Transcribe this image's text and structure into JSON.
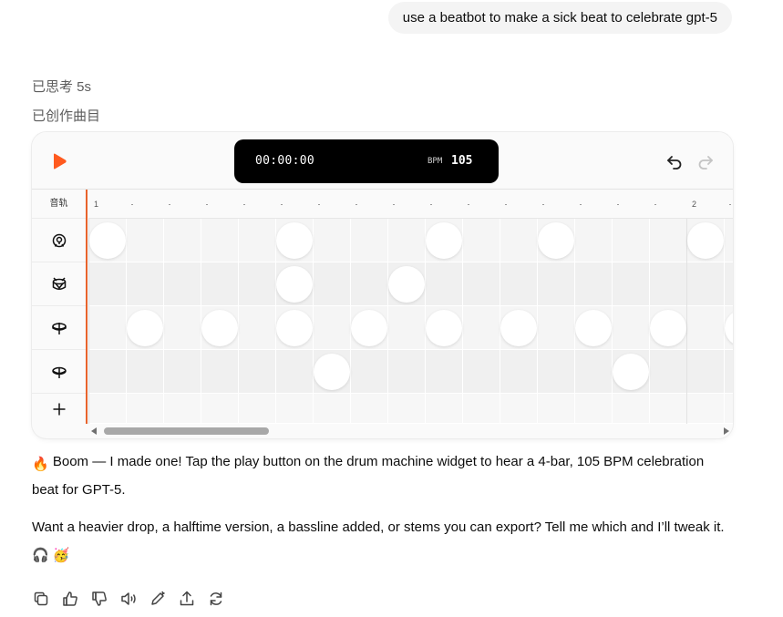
{
  "user_message": "use a beatbot to make a sick beat to celebrate gpt-5",
  "thought_label": "已思考 5s",
  "created_label": "已创作曲目",
  "widget": {
    "time": "00:00:00",
    "bpm_label": "BPM",
    "bpm_value": "105",
    "tracks_header": "音轨",
    "bar_labels": [
      "1",
      "2"
    ],
    "tracks": [
      {
        "icon": "kick-drum-icon",
        "steps": [
          0,
          5,
          9,
          12,
          16
        ]
      },
      {
        "icon": "snare-drum-icon",
        "steps": [
          5,
          8
        ]
      },
      {
        "icon": "hihat-icon",
        "steps": [
          1,
          3,
          5,
          7,
          9,
          11,
          13,
          15,
          17
        ]
      },
      {
        "icon": "cymbal-icon",
        "steps": [
          6,
          14
        ]
      }
    ],
    "accent_color": "#e8632c"
  },
  "response": {
    "p1_emoji": "🔥",
    "p1_text": "Boom — I made one! Tap the play button on the drum machine widget to hear a 4-bar, 105 BPM celebration beat for GPT-5.",
    "p2_text": "Want a heavier drop, a halftime version, a bassline added, or stems you can export? Tell me which and I’ll tweak it.",
    "p2_emoji_1": "🎧",
    "p2_emoji_2": "🥳"
  },
  "actions": [
    "copy-icon",
    "thumbs-up-icon",
    "thumbs-down-icon",
    "read-aloud-icon",
    "edit-icon",
    "share-icon",
    "regenerate-icon"
  ]
}
